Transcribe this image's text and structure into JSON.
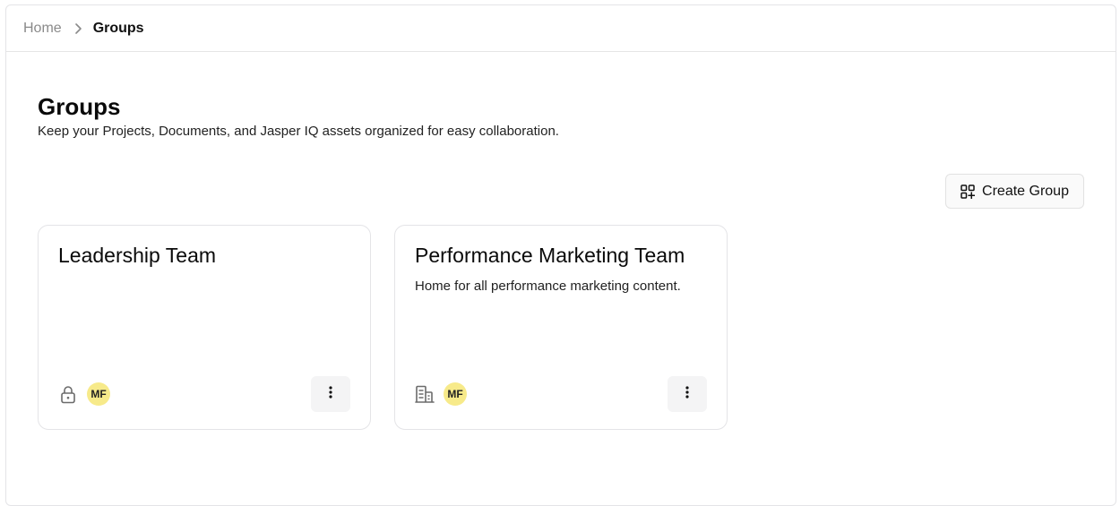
{
  "breadcrumb": {
    "home": "Home",
    "current": "Groups"
  },
  "page": {
    "title": "Groups",
    "subtitle": "Keep your Projects, Documents, and Jasper IQ assets organized for easy collaboration."
  },
  "toolbar": {
    "create_label": "Create Group",
    "create_icon": "grid-plus-icon"
  },
  "groups": [
    {
      "title": "Leadership Team",
      "description": "",
      "visibility_icon": "lock-icon",
      "member_initials": "MF"
    },
    {
      "title": "Performance Marketing Team",
      "description": "Home for all performance marketing content.",
      "visibility_icon": "building-icon",
      "member_initials": "MF"
    }
  ],
  "colors": {
    "avatar_bg": "#f7ea8a",
    "border": "#e4e4e7",
    "muted_text": "#8a8a8a"
  }
}
